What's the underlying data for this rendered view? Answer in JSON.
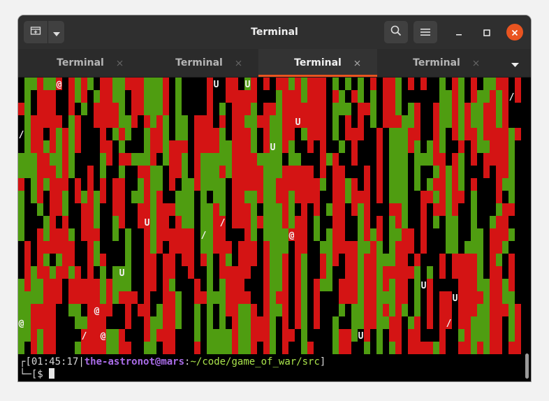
{
  "window": {
    "title": "Terminal"
  },
  "tabs": [
    {
      "label": "Terminal",
      "active": false
    },
    {
      "label": "Terminal",
      "active": false
    },
    {
      "label": "Terminal",
      "active": true
    },
    {
      "label": "Terminal",
      "active": false
    }
  ],
  "icons": {
    "new_tab": "new-tab-icon",
    "dropdown": "chevron-down-icon",
    "search": "search-icon",
    "menu": "hamburger-menu-icon",
    "minimize": "minimize-icon",
    "maximize": "maximize-icon",
    "close": "close-icon",
    "tab_close": "tab-close-icon",
    "tab_list": "tab-list-dropdown-icon"
  },
  "colors": {
    "cell_red": "#d41414",
    "cell_green": "#4f9d11",
    "accent": "#e95420",
    "prompt_user": "#a96ce8",
    "prompt_path": "#a9e34b"
  },
  "game": {
    "markers": [
      {
        "ch": "@",
        "col": 6,
        "row": 0
      },
      {
        "ch": "U",
        "col": 31,
        "row": 0
      },
      {
        "ch": "U",
        "col": 36,
        "row": 0
      },
      {
        "ch": "/",
        "col": 78,
        "row": 1
      },
      {
        "ch": "U",
        "col": 44,
        "row": 3
      },
      {
        "ch": "/",
        "col": 0,
        "row": 4
      },
      {
        "ch": "U",
        "col": 40,
        "row": 5
      },
      {
        "ch": "U",
        "col": 20,
        "row": 11
      },
      {
        "ch": "/",
        "col": 32,
        "row": 11
      },
      {
        "ch": "/",
        "col": 29,
        "row": 12
      },
      {
        "ch": "@",
        "col": 43,
        "row": 12
      },
      {
        "ch": "U",
        "col": 16,
        "row": 15
      },
      {
        "ch": "U",
        "col": 64,
        "row": 16
      },
      {
        "ch": "U",
        "col": 69,
        "row": 17
      },
      {
        "ch": "@",
        "col": 12,
        "row": 18
      },
      {
        "ch": "@",
        "col": 0,
        "row": 19
      },
      {
        "ch": "/",
        "col": 68,
        "row": 19
      },
      {
        "ch": "/",
        "col": 10,
        "row": 20
      },
      {
        "ch": "@",
        "col": 13,
        "row": 20
      },
      {
        "ch": "U",
        "col": 54,
        "row": 20
      }
    ]
  },
  "prompt": {
    "corner_top": "┌",
    "corner_bottom": "└",
    "bracket_open": "[",
    "time": "01:45:17",
    "sep": "|",
    "user_host": "the-astronot@mars",
    "colon": ":",
    "path": "~/code/game_of_war/src",
    "bracket_close": "]",
    "line2_prefix": "─[$ "
  }
}
